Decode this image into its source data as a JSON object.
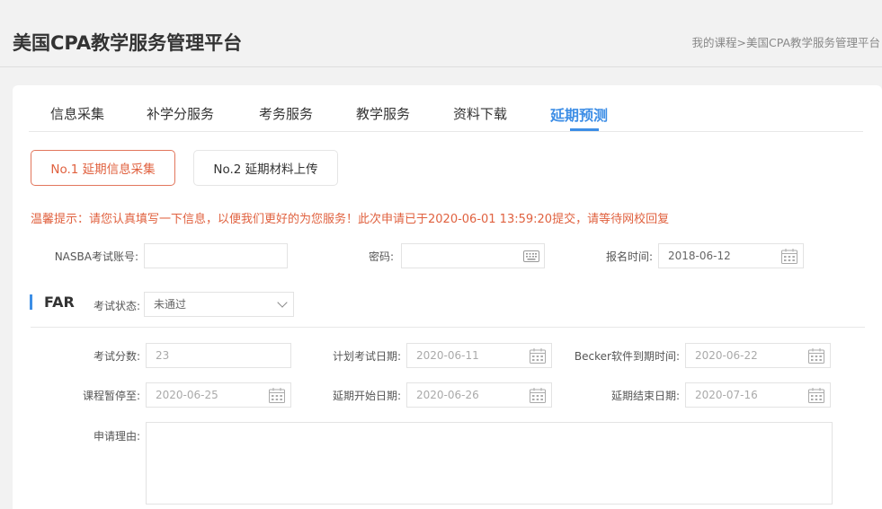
{
  "header": {
    "title": "美国CPA教学服务管理平台",
    "breadcrumb": "我的课程>美国CPA教学服务管理平台"
  },
  "tabs": [
    {
      "label": "信息采集",
      "active": false
    },
    {
      "label": "补学分服务",
      "active": false
    },
    {
      "label": "考务服务",
      "active": false
    },
    {
      "label": "教学服务",
      "active": false
    },
    {
      "label": "资料下载",
      "active": false
    },
    {
      "label": "延期预测",
      "active": true
    }
  ],
  "steps": [
    {
      "label": "No.1 延期信息采集",
      "active": true
    },
    {
      "label": "No.2 延期材料上传",
      "active": false
    }
  ],
  "notice": "温馨提示：请您认真填写一下信息，以便我们更好的为您服务！此次申请已于2020-06-01 13:59:20提交，请等待网校回复",
  "account": {
    "nasba_label": "NASBA考试账号:",
    "nasba_value": "",
    "password_label": "密码:",
    "password_value": "",
    "signup_label": "报名时间:",
    "signup_value": "2018-06-12"
  },
  "section": {
    "title": "FAR",
    "status_label": "考试状态:",
    "status_value": "未通过"
  },
  "form": {
    "score_label": "考试分数:",
    "score_value": "23",
    "plan_date_label": "计划考试日期:",
    "plan_date_value": "2020-06-11",
    "becker_label": "Becker软件到期时间:",
    "becker_value": "2020-06-22",
    "pause_label": "课程暂停至:",
    "pause_value": "2020-06-25",
    "delay_start_label": "延期开始日期:",
    "delay_start_value": "2020-06-26",
    "delay_end_label": "延期结束日期:",
    "delay_end_value": "2020-07-16",
    "reason_label": "申请理由:",
    "reason_value": ""
  },
  "colors": {
    "accent": "#3d8ee6",
    "warning": "#e0613f"
  }
}
